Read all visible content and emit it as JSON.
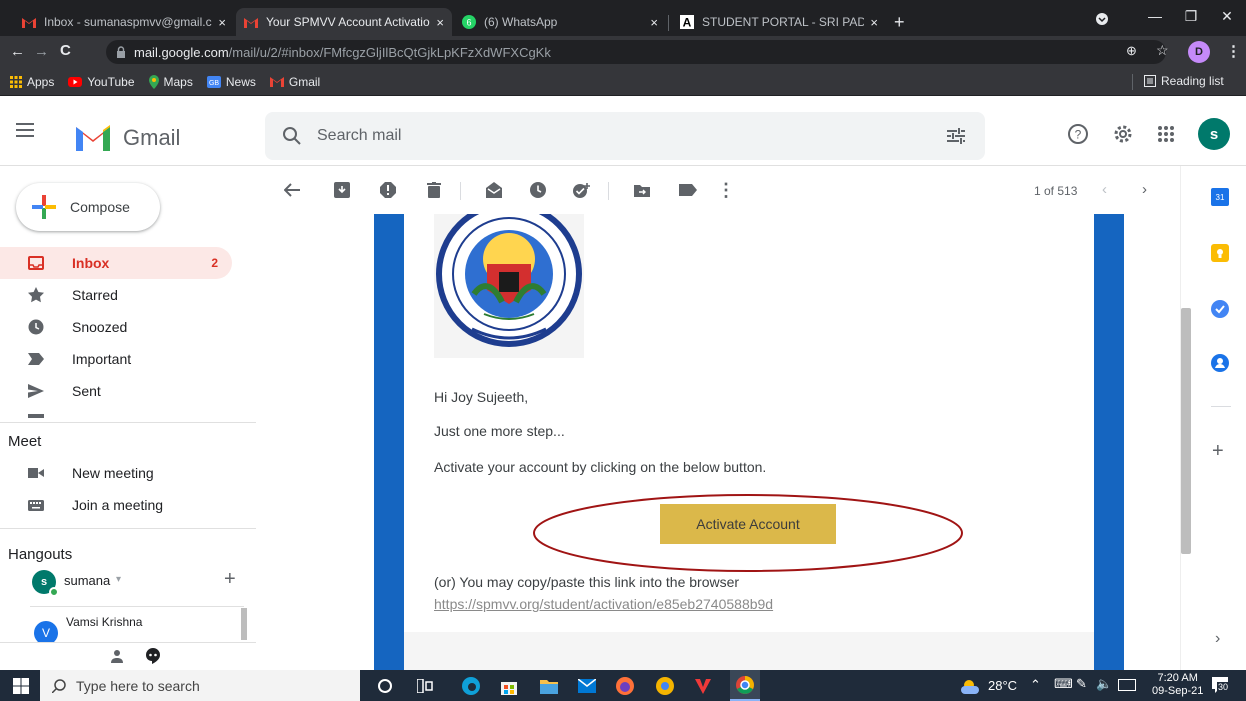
{
  "browser": {
    "tabs": [
      {
        "title": "Inbox - sumanaspmvv@gmail.co",
        "close": "×"
      },
      {
        "title": "Your SPMVV Account Activation",
        "close": "×"
      },
      {
        "title": "(6) WhatsApp",
        "close": "×"
      },
      {
        "title": "STUDENT PORTAL - SRI PADMAV",
        "close": "×"
      }
    ],
    "new_tab": "+",
    "url_host": "mail.google.com",
    "url_path": "/mail/u/2/#inbox/FMfcgzGljIlBcQtGjkLpKFzXdWFXCgKk",
    "profile_initial": "D",
    "bookmarks": [
      "Apps",
      "YouTube",
      "Maps",
      "News",
      "Gmail"
    ],
    "reading_list": "Reading list"
  },
  "gmail": {
    "logo_text": "Gmail",
    "search_placeholder": "Search mail",
    "account_initial": "s",
    "compose": "Compose",
    "nav": [
      {
        "label": "Inbox",
        "count": "2"
      },
      {
        "label": "Starred",
        "count": ""
      },
      {
        "label": "Snoozed",
        "count": ""
      },
      {
        "label": "Important",
        "count": ""
      },
      {
        "label": "Sent",
        "count": ""
      }
    ],
    "meet": {
      "title": "Meet",
      "new_meeting": "New meeting",
      "join": "Join a meeting"
    },
    "hangouts": {
      "title": "Hangouts",
      "user": "sumana",
      "user_initial": "s",
      "contact": "Vamsi Krishna",
      "contact_initial": "V"
    },
    "pager": "1 of 513",
    "colors": {
      "inbox_red": "#d93025",
      "activate_btn": "#dbb84a",
      "mail_frame_blue": "#1565c0"
    }
  },
  "email": {
    "greeting": "Hi Joy Sujeeth,",
    "line1": "Just one more step...",
    "line2": "Activate your account by clicking on the below button.",
    "button": "Activate Account",
    "alt_text": "(or) You may copy/paste this link into the browser",
    "link": "https://spmvv.org/student/activation/e85eb2740588b9d"
  },
  "taskbar": {
    "search_placeholder": "Type here to search",
    "weather": "28°C",
    "time": "7:20 AM",
    "date": "09-Sep-21",
    "notifications": "30"
  }
}
